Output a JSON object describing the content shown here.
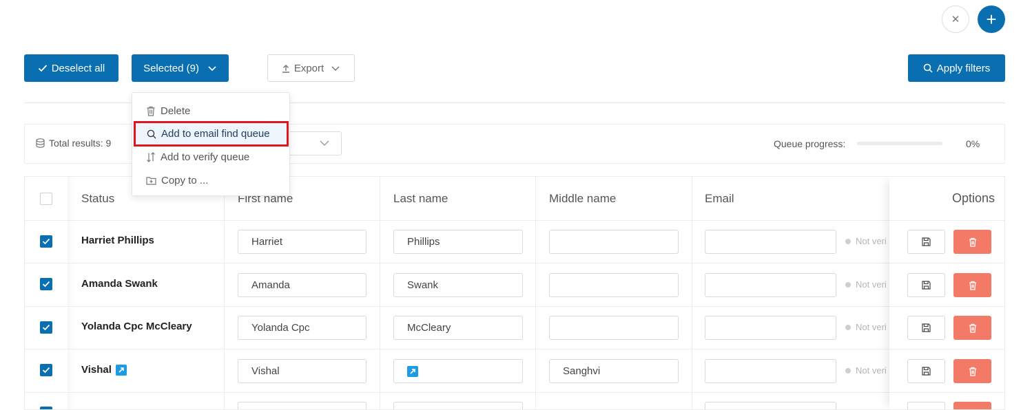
{
  "header": {
    "close_icon": "close-icon",
    "add_icon": "plus-icon"
  },
  "toolbar": {
    "deselect_label": "Deselect all",
    "selected_label": "Selected (9)",
    "export_label": "Export",
    "apply_filters_label": "Apply filters"
  },
  "dropdown": {
    "items": [
      {
        "label": "Delete",
        "icon": "trash-icon"
      },
      {
        "label": "Add to email find queue",
        "icon": "search-icon",
        "highlighted": true
      },
      {
        "label": "Add to verify queue",
        "icon": "sort-arrows-icon"
      },
      {
        "label": "Copy to ...",
        "icon": "folder-plus-icon"
      }
    ]
  },
  "summary": {
    "total_results": "Total results: 9",
    "queue_progress_label": "Queue progress:",
    "queue_progress_value": "0%",
    "queue_progress_fraction": 0
  },
  "table": {
    "columns": [
      "Status",
      "First name",
      "Last name",
      "Middle name",
      "Email",
      "Options"
    ],
    "rows": [
      {
        "name": "Harriet Phillips",
        "first": "Harriet",
        "last": "Phillips",
        "middle": "",
        "email": "",
        "status": "Not veri",
        "checked": true
      },
      {
        "name": "Amanda Swank",
        "first": "Amanda",
        "last": "Swank",
        "middle": "",
        "email": "",
        "status": "Not veri",
        "checked": true
      },
      {
        "name": "Yolanda Cpc McCleary",
        "first": "Yolanda Cpc",
        "last": "McCleary",
        "middle": "",
        "email": "",
        "status": "Not veri",
        "checked": true
      },
      {
        "name": "Vishal",
        "first": "Vishal",
        "last": "",
        "middle": "Sanghvi",
        "email": "",
        "status": "Not veri",
        "checked": true
      }
    ]
  },
  "colors": {
    "primary": "#0a6fb0",
    "danger": "#f47a68",
    "highlight_border": "#e0151f"
  }
}
